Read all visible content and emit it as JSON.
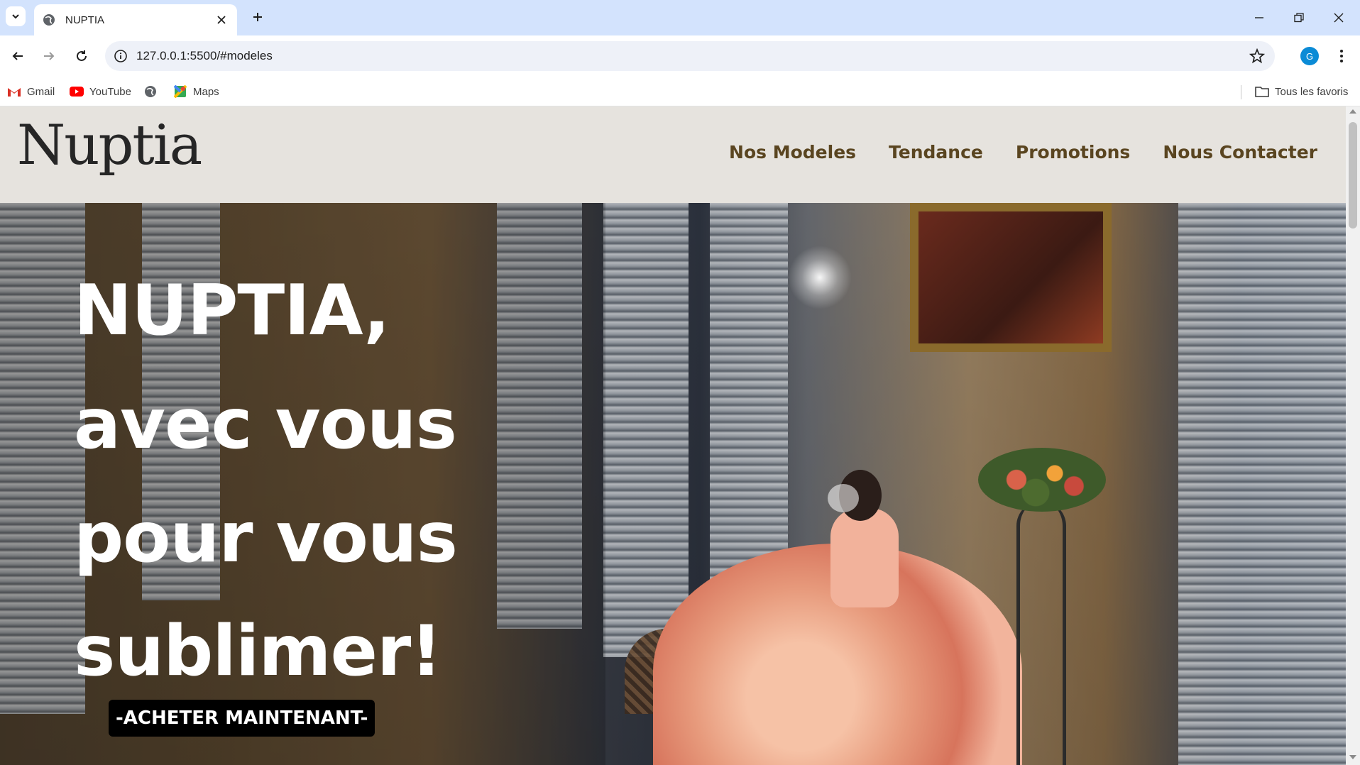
{
  "browser": {
    "tab": {
      "title": "NUPTIA"
    },
    "address_bar": {
      "url": "127.0.0.1:5500/#modeles"
    },
    "profile_initial": "G",
    "bookmarks": [
      {
        "label": "Gmail",
        "icon": "gmail-icon"
      },
      {
        "label": "YouTube",
        "icon": "youtube-icon"
      },
      {
        "label": "",
        "icon": "globe-icon"
      },
      {
        "label": "Maps",
        "icon": "maps-icon"
      }
    ],
    "all_bookmarks_label": "Tous les favoris"
  },
  "site": {
    "logo": "Nuptia",
    "nav": [
      {
        "label": "Nos Modeles"
      },
      {
        "label": "Tendance"
      },
      {
        "label": "Promotions"
      },
      {
        "label": "Nous Contacter"
      }
    ],
    "hero": {
      "title_lines": [
        "NUPTIA,",
        "avec vous",
        "pour vous",
        "sublimer!"
      ],
      "cta_label": "-ACHETER MAINTENANT-"
    }
  },
  "colors": {
    "tabbar_bg": "#d3e3fd",
    "header_bg": "#e6e3de",
    "nav_text": "#5a4520",
    "cta_bg": "#000000",
    "hero_text": "#ffffff"
  }
}
